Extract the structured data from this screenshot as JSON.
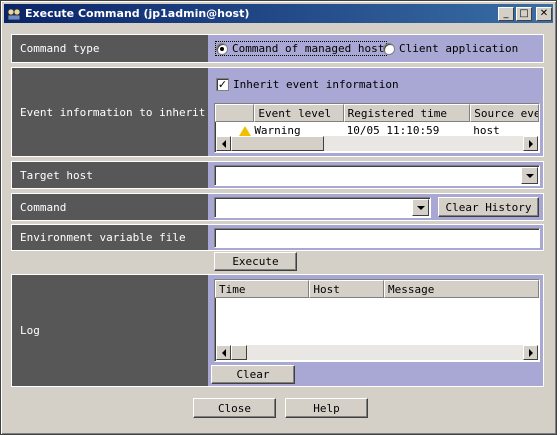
{
  "window": {
    "title": "Execute Command (jp1admin@host)",
    "minimize_glyph": "_",
    "maximize_glyph": "□",
    "close_glyph": "✕"
  },
  "command_type": {
    "label": "Command type",
    "options": [
      {
        "label": "Command of managed host",
        "selected": true
      },
      {
        "label": "Client application",
        "selected": false
      }
    ]
  },
  "event_info": {
    "label": "Event information to inherit",
    "inherit_checkbox_label": "Inherit event information",
    "inherit_checked": true,
    "check_glyph": "✓",
    "columns": [
      "Event level",
      "Registered time",
      "Source eve"
    ],
    "rows": [
      {
        "level": "Warning",
        "time": "10/05 11:10:59",
        "source": "host"
      }
    ]
  },
  "target_host": {
    "label": "Target host",
    "value": ""
  },
  "command": {
    "label": "Command",
    "value": "",
    "clear_history_label": "Clear History"
  },
  "env_file": {
    "label": "Environment variable file",
    "value": ""
  },
  "execute_label": "Execute",
  "log": {
    "label": "Log",
    "columns": [
      "Time",
      "Host",
      "Message"
    ],
    "clear_label": "Clear"
  },
  "footer": {
    "close_label": "Close",
    "help_label": "Help"
  }
}
